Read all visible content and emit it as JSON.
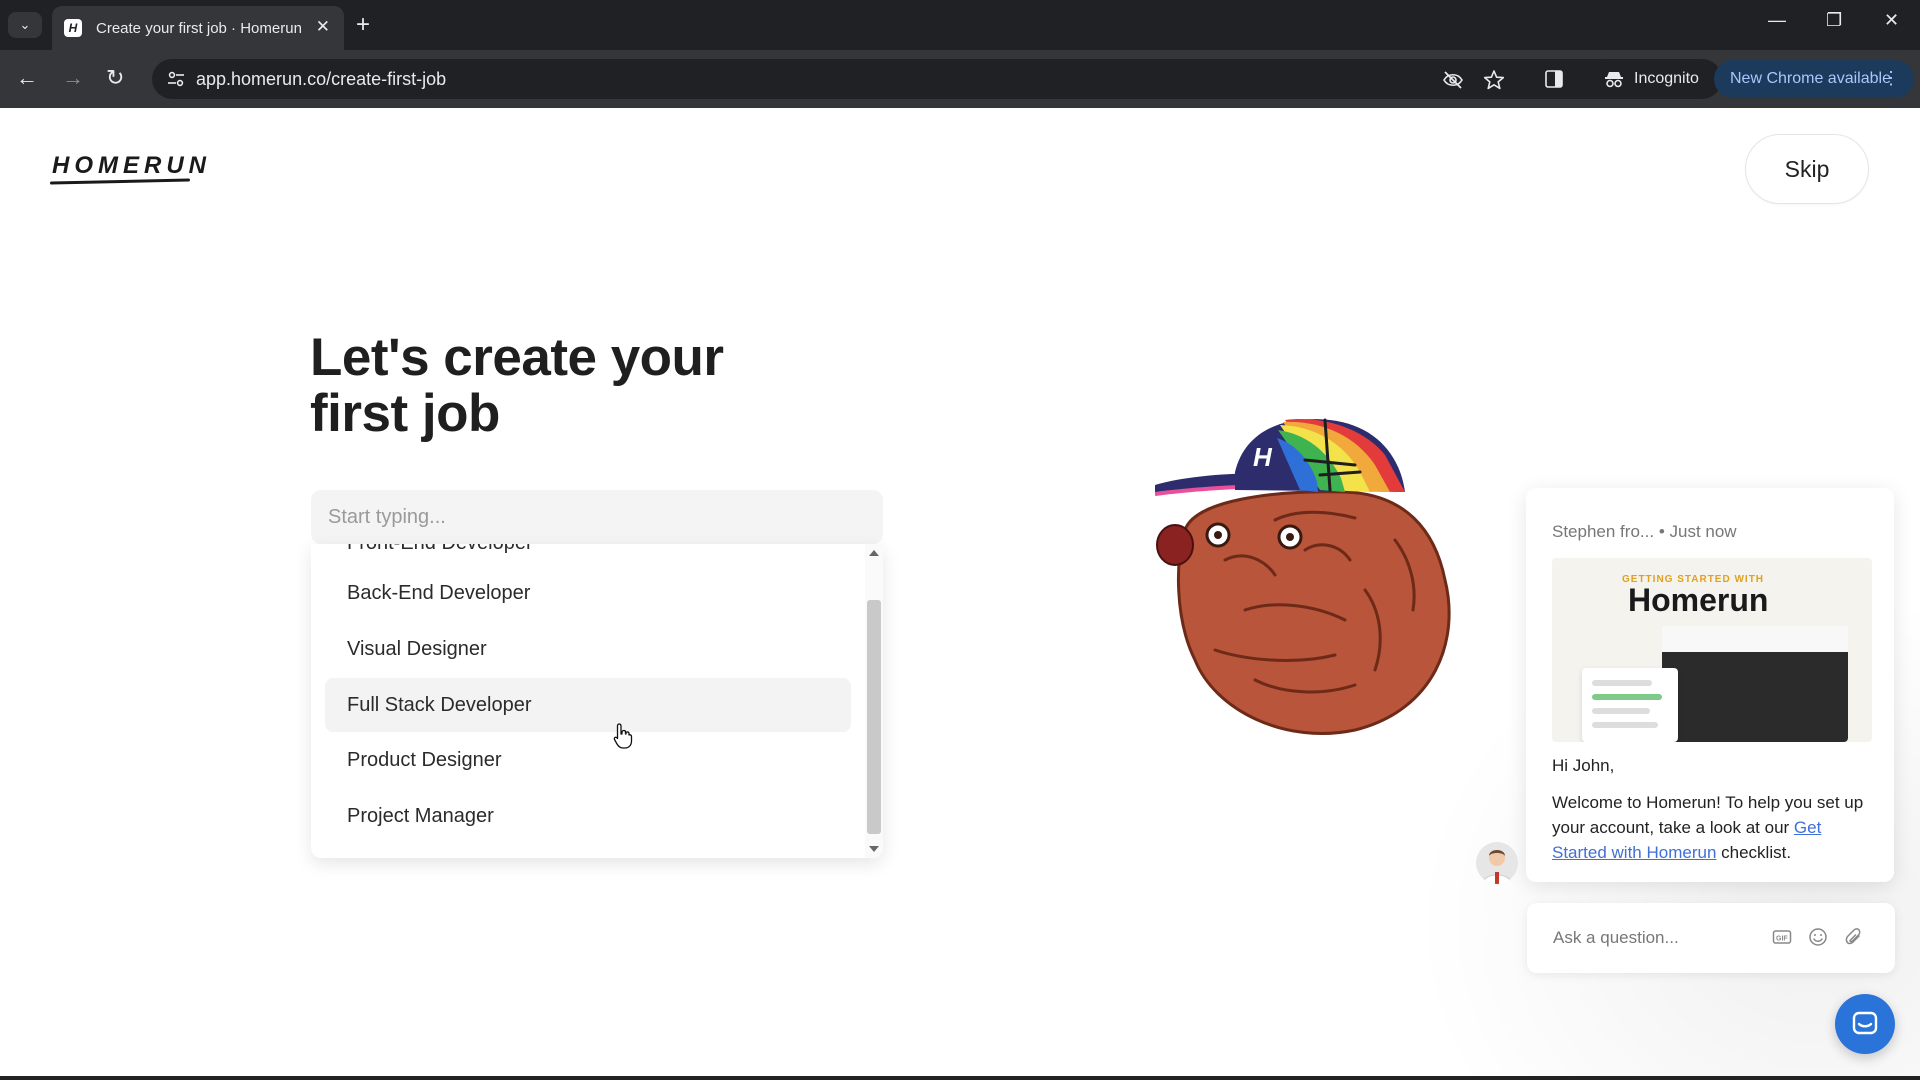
{
  "browser": {
    "tab_title": "Create your first job · Homerun",
    "favicon_letter": "H",
    "url": "app.homerun.co/create-first-job",
    "incognito_label": "Incognito",
    "update_label": "New Chrome available"
  },
  "page": {
    "logo": "HOMERUN",
    "skip_label": "Skip",
    "heading": "Let's create your first job",
    "search_placeholder": "Start typing...",
    "options": [
      "Front-End Developer",
      "Back-End Developer",
      "Visual Designer",
      "Full Stack Developer",
      "Product Designer",
      "Project Manager"
    ],
    "hovered_option_index": 3,
    "mascot_cap_letter": "H"
  },
  "chat": {
    "sender": "Stephen fro...",
    "time": "• Just now",
    "image_kicker": "GETTING STARTED WITH",
    "image_title": "Homerun",
    "greeting": "Hi John,",
    "message_pre": "Welcome to Homerun! To help you set up your account, take a look at our ",
    "message_link": "Get Started with Homerun",
    "message_post": " checklist.",
    "ask_placeholder": "Ask a question..."
  },
  "icons": {
    "tab_list": "chevron-down-icon",
    "back": "arrow-left-icon",
    "forward": "arrow-right-icon",
    "reload": "reload-icon",
    "site_info": "tune-icon",
    "eye_off": "eye-off-icon",
    "bookmark": "star-icon",
    "side_panel": "side-panel-icon",
    "incognito": "incognito-icon",
    "gif": "gif-icon",
    "emoji": "emoji-icon",
    "attach": "paperclip-icon",
    "launcher": "chat-icon"
  },
  "colors": {
    "accent_blue": "#2a73d8",
    "link_blue": "#3f6fd8",
    "hover_bg": "#f3f3f3",
    "mascot_brown": "#b8553a"
  }
}
